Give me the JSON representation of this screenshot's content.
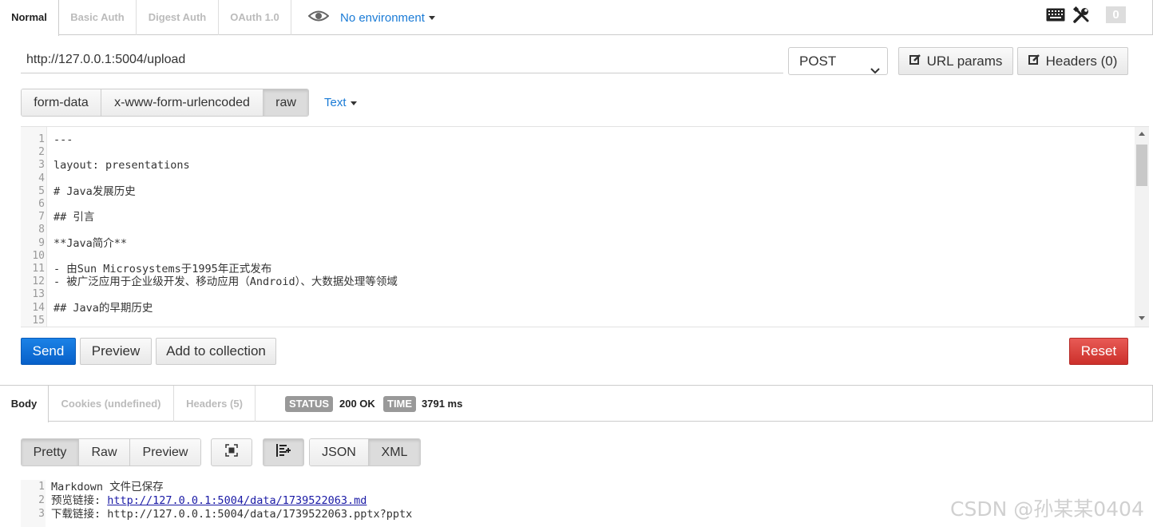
{
  "auth_tabs": [
    "Normal",
    "Basic Auth",
    "Digest Auth",
    "OAuth 1.0"
  ],
  "environment": "No environment",
  "env_count": "0",
  "request": {
    "url": "http://127.0.0.1:5004/upload",
    "method": "POST",
    "url_params_label": "URL params",
    "headers_label": "Headers (0)"
  },
  "body_modes": [
    "form-data",
    "x-www-form-urlencoded",
    "raw"
  ],
  "body_mode_active": "raw",
  "raw_type": "Text",
  "editor": {
    "line_numbers": [
      "1",
      "2",
      "3",
      "4",
      "5",
      "6",
      "7",
      "8",
      "9",
      "10",
      "11",
      "12",
      "13",
      "14",
      "15"
    ],
    "lines": [
      "---",
      "",
      "layout: presentations",
      "",
      "# Java发展历史",
      "",
      "## 引言",
      "",
      "**Java简介**",
      "",
      "- 由Sun Microsystems于1995年正式发布",
      "- 被广泛应用于企业级开发、移动应用（Android）、大数据处理等领域",
      "",
      "## Java的早期历史",
      ""
    ]
  },
  "actions": {
    "send": "Send",
    "preview": "Preview",
    "add_collection": "Add to collection",
    "reset": "Reset"
  },
  "response": {
    "tabs": [
      "Body",
      "Cookies (undefined)",
      "Headers (5)"
    ],
    "status_label": "STATUS",
    "status_value": "200 OK",
    "time_label": "TIME",
    "time_value": "3791 ms",
    "view_modes": [
      "Pretty",
      "Raw",
      "Preview"
    ],
    "formats": [
      "JSON",
      "XML"
    ],
    "line_numbers": [
      "1",
      "2",
      "3"
    ],
    "line1": "Markdown 文件已保存",
    "line2_prefix": "预览链接: ",
    "line2_link": "http://127.0.0.1:5004/data/1739522063.md",
    "line3": "下载链接: http://127.0.0.1:5004/data/1739522063.pptx?pptx"
  },
  "watermark": "CSDN @孙某某0404",
  "colors": {
    "send": "#0a6fd8",
    "reset": "#d9413c",
    "link_blue": "#1a7bd6"
  }
}
